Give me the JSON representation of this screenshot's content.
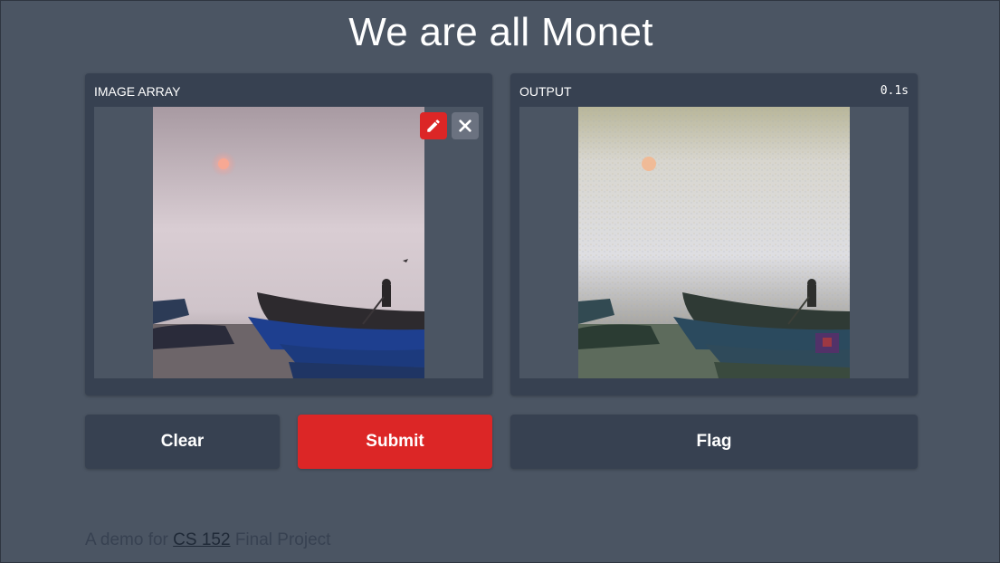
{
  "app": {
    "title": "We are all Monet"
  },
  "input_panel": {
    "label": "IMAGE ARRAY",
    "image_alt": "Boats on misty water at dawn"
  },
  "output_panel": {
    "label": "OUTPUT",
    "time": "0.1s",
    "image_alt": "Monet-style stylized boats on misty water"
  },
  "buttons": {
    "clear": "Clear",
    "submit": "Submit",
    "flag": "Flag"
  },
  "footer": {
    "prefix": "A demo for",
    "link": "CS 152",
    "suffix": "Final Project"
  },
  "colors": {
    "background": "#4b5563",
    "panel": "#374151",
    "accent": "#dc2626",
    "secondary": "#6b7280"
  },
  "icons": {
    "edit": "pencil-icon",
    "close": "close-icon"
  }
}
